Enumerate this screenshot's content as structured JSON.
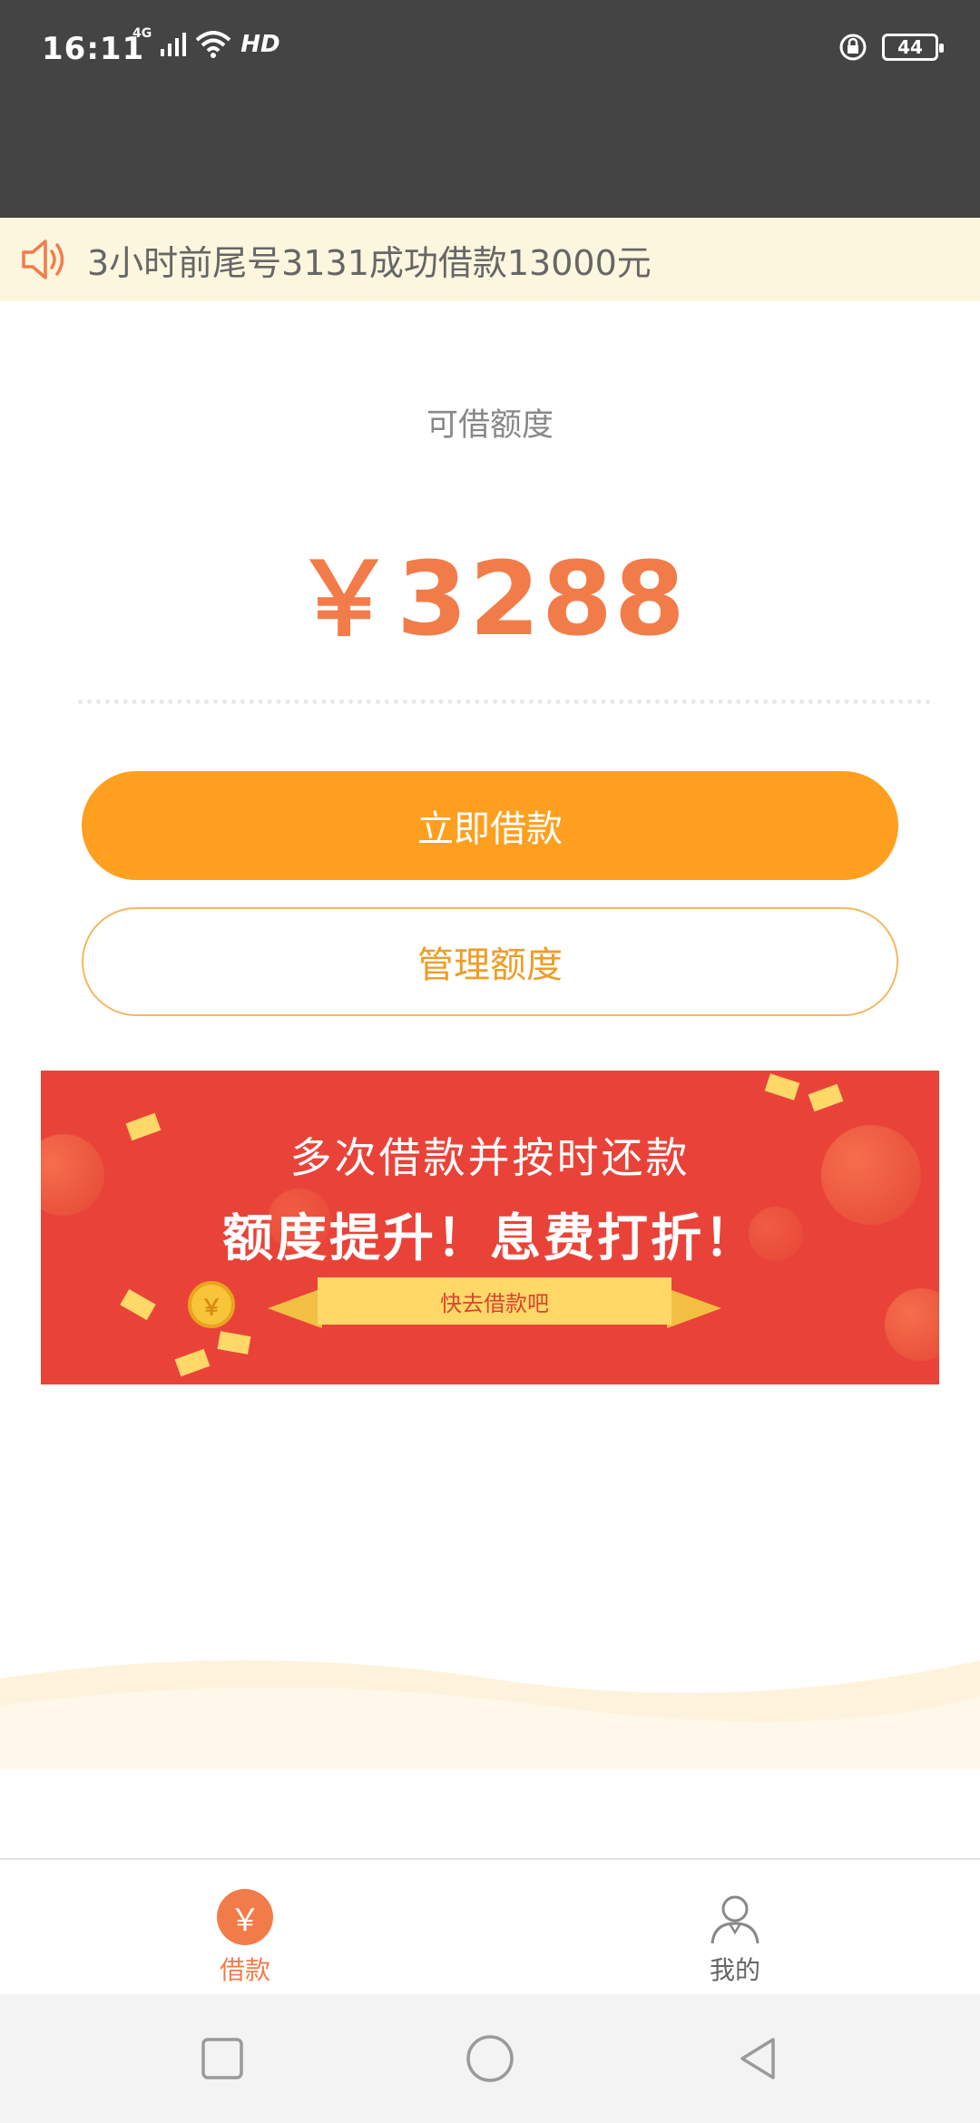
{
  "status_bar": {
    "time": "16:11",
    "network": "4G",
    "hd": "HD",
    "battery": "44"
  },
  "ticker": {
    "icon": "speaker-icon",
    "text": "3小时前尾号3131成功借款13000元"
  },
  "credit": {
    "label": "可借额度",
    "amount": "￥3288"
  },
  "buttons": {
    "borrow_now": "立即借款",
    "manage_limit": "管理额度"
  },
  "banner": {
    "line1": "多次借款并按时还款",
    "line2": "额度提升！息费打折！",
    "ribbon": "快去借款吧",
    "coin_symbol": "￥"
  },
  "tabbar": {
    "items": [
      {
        "label": "借款",
        "icon": "yen-icon",
        "glyph": "￥",
        "active": true
      },
      {
        "label": "我的",
        "icon": "user-icon",
        "active": false
      }
    ]
  },
  "nav": {
    "items": [
      "recent-apps",
      "home",
      "back"
    ]
  },
  "colors": {
    "accent": "#f27c49",
    "primary_button": "#ff9f1f",
    "banner_red": "#e94339",
    "ticker_bg": "#fdf6df"
  }
}
